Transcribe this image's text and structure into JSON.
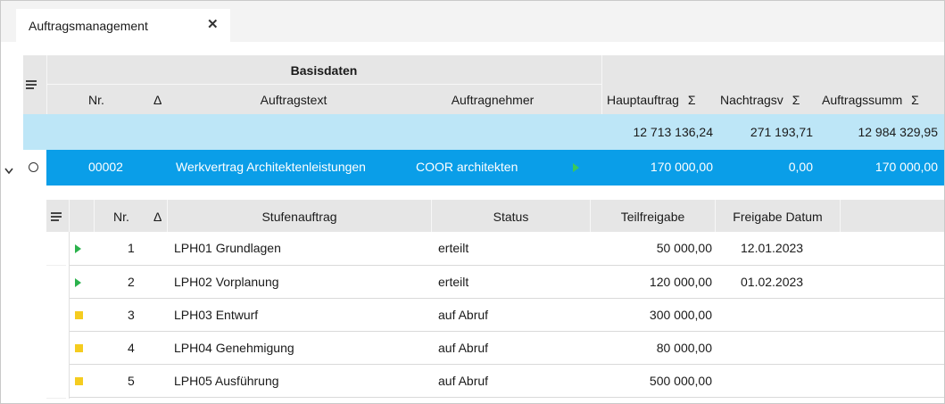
{
  "tab": {
    "title": "Auftragsmanagement",
    "close_glyph": "✕"
  },
  "main": {
    "group_header": "Basisdaten",
    "columns": {
      "nr": "Nr.",
      "sort_glyph": "Δ",
      "auftragstext": "Auftragstext",
      "auftragnehmer": "Auftragnehmer",
      "hauptauftrag": "Hauptauftrag",
      "nachtragsv": "Nachtragsv",
      "auftragssumm": "Auftragssumm",
      "sigma": "Σ"
    },
    "totals": {
      "hauptauftrag": "12 713 136,24",
      "nachtragsv": "271 193,71",
      "auftragssumm": "12 984 329,95"
    },
    "row": {
      "nr": "00002",
      "auftragstext": "Werkvertrag Architektenleistungen",
      "auftragnehmer": "COOR architekten",
      "hauptauftrag": "170 000,00",
      "nachtragsv": "0,00",
      "auftragssumm": "170 000,00"
    }
  },
  "sub": {
    "columns": {
      "nr": "Nr.",
      "sort_glyph": "Δ",
      "stufenauftrag": "Stufenauftrag",
      "status": "Status",
      "teilfreigabe": "Teilfreigabe",
      "freigabe_datum": "Freigabe Datum"
    },
    "rows": [
      {
        "icon": "play-icon",
        "nr": "1",
        "stufenauftrag": "LPH01 Grundlagen",
        "status": "erteilt",
        "teilfreigabe": "50 000,00",
        "freigabe_datum": "12.01.2023"
      },
      {
        "icon": "play-icon",
        "nr": "2",
        "stufenauftrag": "LPH02 Vorplanung",
        "status": "erteilt",
        "teilfreigabe": "120 000,00",
        "freigabe_datum": "01.02.2023"
      },
      {
        "icon": "pending-square-icon",
        "nr": "3",
        "stufenauftrag": "LPH03 Entwurf",
        "status": "auf Abruf",
        "teilfreigabe": "300 000,00",
        "freigabe_datum": ""
      },
      {
        "icon": "pending-square-icon",
        "nr": "4",
        "stufenauftrag": "LPH04 Genehmigung",
        "status": "auf Abruf",
        "teilfreigabe": "80 000,00",
        "freigabe_datum": ""
      },
      {
        "icon": "pending-square-icon",
        "nr": "5",
        "stufenauftrag": "LPH05 Ausführung",
        "status": "auf Abruf",
        "teilfreigabe": "500 000,00",
        "freigabe_datum": ""
      }
    ]
  },
  "colors": {
    "selection": "#0a9ee8",
    "totals_row": "#bde6f7",
    "status_green": "#2bb24c",
    "status_yellow": "#f5cc1f",
    "header_bg": "#e6e6e6"
  }
}
